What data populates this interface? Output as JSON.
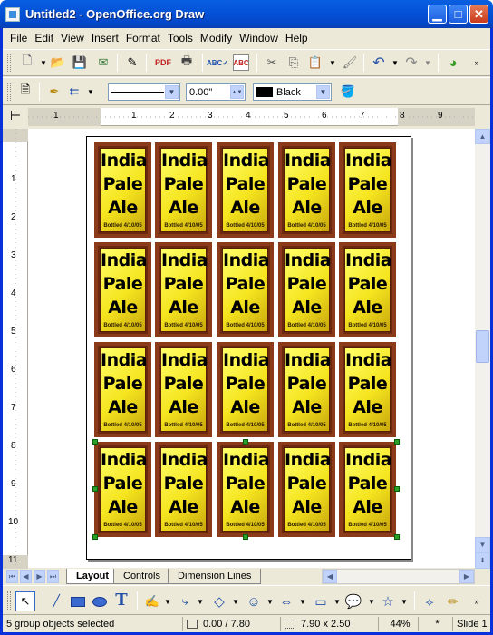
{
  "window": {
    "title": "Untitled2 - OpenOffice.org Draw"
  },
  "menu": [
    "File",
    "Edit",
    "View",
    "Insert",
    "Format",
    "Tools",
    "Modify",
    "Window",
    "Help"
  ],
  "line_format": {
    "width_value": "0.00\"",
    "color_value": "Black"
  },
  "ruler": {
    "h_labels": [
      "1",
      "1",
      "2",
      "3",
      "4",
      "5",
      "6",
      "7",
      "8",
      "9"
    ],
    "v_labels": [
      "1",
      "2",
      "3",
      "4",
      "5",
      "6",
      "7",
      "8",
      "9",
      "10",
      "11"
    ]
  },
  "label": {
    "line1": "India",
    "line2": "Pale",
    "line3": "Ale",
    "bottled": "Bottled 4/10/05"
  },
  "tabs": [
    "Layout",
    "Controls",
    "Dimension Lines"
  ],
  "status": {
    "selection": "5 group objects selected",
    "position": "0.00 / 7.80",
    "size": "7.90 x 2.50",
    "zoom": "44%",
    "modified": "*",
    "slide": "Slide 1"
  },
  "colors": {
    "titlebar": "#0453d8",
    "label_frame": "#8b3a1a",
    "label_fill": "#f5e51f",
    "handle": "#2aa02a"
  }
}
